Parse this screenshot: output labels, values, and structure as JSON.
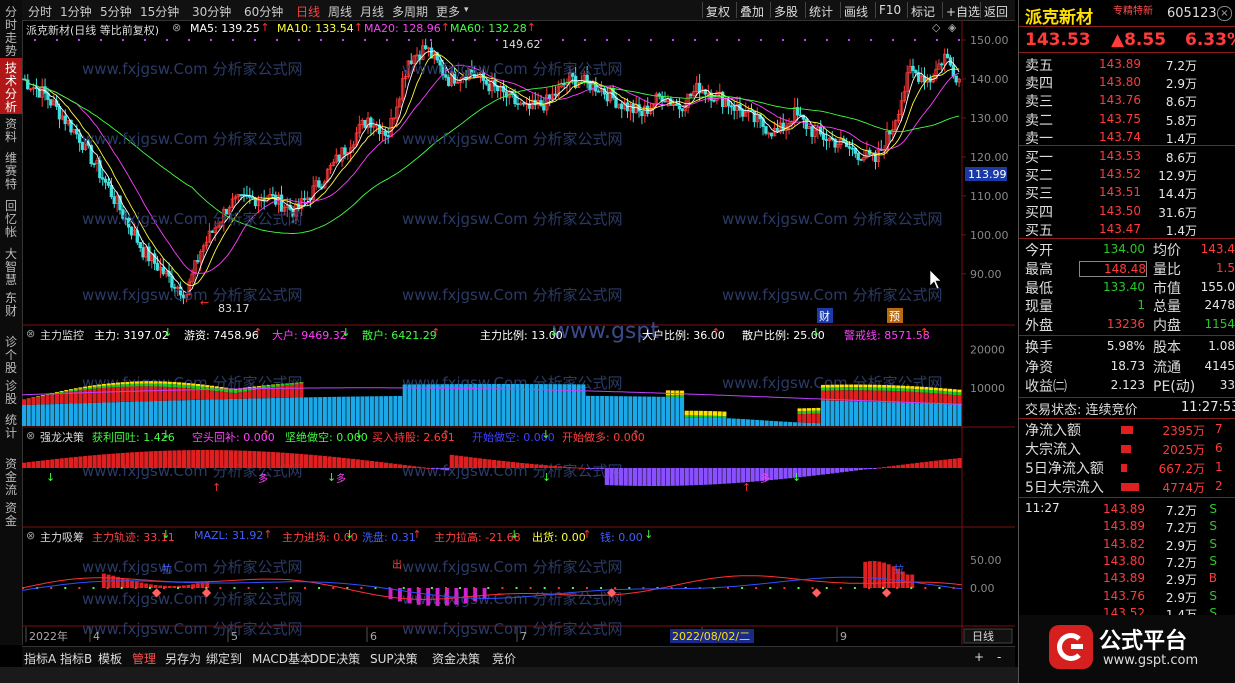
{
  "left_rail": [
    "分时走势",
    "技术分析",
    "资料",
    "维赛特",
    "回忆帐",
    "大智慧",
    "东财",
    "诊个股",
    "诊股",
    "统计",
    "资金流",
    "资金"
  ],
  "left_rail_active": 1,
  "toolbar": {
    "timeframes": [
      "分时",
      "1分钟",
      "5分钟",
      "15分钟",
      "30分钟",
      "60分钟",
      "日线",
      "周线",
      "月线",
      "多周期",
      "更多"
    ],
    "active_timeframe": "日线",
    "buttons": [
      "复权",
      "叠加",
      "多股",
      "统计",
      "画线",
      "F10",
      "标记",
      "+自选",
      "返回"
    ]
  },
  "main_chart": {
    "title": "派克新材(日线 等比前复权)",
    "ma": [
      {
        "label": "MA5: 139.25",
        "color": "#ffffff"
      },
      {
        "label": "MA10: 133.54",
        "color": "#ffff40"
      },
      {
        "label": "MA20: 128.96",
        "color": "#ff40ff"
      },
      {
        "label": "MA60: 132.28",
        "color": "#40ff40"
      }
    ],
    "high_label": "149.62",
    "low_label": "83.17",
    "current_price_box": "113.99",
    "price_axis": [
      "150.00",
      "140.00",
      "130.00",
      "120.00",
      "110.00",
      "100.00",
      "90.00"
    ],
    "markers": [
      "财",
      "预"
    ],
    "watermarks": [
      "www.fxjgsw.Com",
      "分析家公式网",
      "www.gspt"
    ]
  },
  "panel_zhuli": {
    "title": "主力监控",
    "items": [
      {
        "text": "主力: 3197.02",
        "color": "#ffffff"
      },
      {
        "text": "游资: 7458.96",
        "color": "#ffffff"
      },
      {
        "text": "大户: 9469.32",
        "color": "#ff40ff"
      },
      {
        "text": "散户: 6421.29",
        "color": "#40ff40"
      },
      {
        "text": "主力比例: 13.00",
        "color": "#ffffff"
      },
      {
        "text": "大户比例: 36.00",
        "color": "#ffffff"
      },
      {
        "text": "散户比例: 25.00",
        "color": "#ffffff"
      },
      {
        "text": "警戒线: 8571.58",
        "color": "#ff40ff"
      }
    ],
    "axis": [
      "20000",
      "10000"
    ]
  },
  "panel_qianglong": {
    "title": "强龙决策",
    "items": [
      {
        "text": "获利回吐: 1.426",
        "color": "#40ff40"
      },
      {
        "text": "空头回补: 0.000",
        "color": "#ff40ff"
      },
      {
        "text": "坚绝做空: 0.000",
        "color": "#40ff40"
      },
      {
        "text": "买入持股: 2.691",
        "color": "#ff4040"
      },
      {
        "text": "开始做空: 0.000",
        "color": "#4040ff"
      },
      {
        "text": "开始做多: 0.000",
        "color": "#ff4040"
      }
    ],
    "tags": [
      "多",
      "多",
      "多"
    ]
  },
  "panel_xichou": {
    "title": "主力吸筹",
    "items": [
      {
        "text": "主力轨迹: 33.11",
        "color": "#ff4040"
      },
      {
        "text": "MAZL: 31.92",
        "color": "#4060ff"
      },
      {
        "text": "主力进场: 0.00",
        "color": "#ff4040"
      },
      {
        "text": "洗盘: 0.31",
        "color": "#4060ff"
      },
      {
        "text": "主力拉高: -21.68",
        "color": "#ff4040"
      },
      {
        "text": "出货: 0.00",
        "color": "#ffff40"
      },
      {
        "text": "钱: 0.00",
        "color": "#4060ff"
      }
    ],
    "axis": [
      "50.00",
      "0.00"
    ],
    "tags": [
      "拉",
      "出",
      "拉"
    ]
  },
  "date_axis": {
    "labels": [
      "2022年",
      "4",
      "5",
      "6",
      "7",
      "8",
      "9"
    ],
    "cursor_date": "2022/08/02/二",
    "period": "日线"
  },
  "bottom_tabs": [
    "指标A",
    "指标B",
    "模板",
    "管理",
    "另存为",
    "绑定到",
    "MACD基本",
    "DDE决策",
    "SUP决策",
    "资金决策",
    "竞价"
  ],
  "bottom_active": "管理",
  "right_panel": {
    "name": "派克新材",
    "tag": "专精特新",
    "code": "605123",
    "price": "143.53",
    "change": "▲8.55",
    "pct": "6.33%",
    "asks": [
      {
        "label": "卖五",
        "price": "143.89",
        "vol": "7.2万"
      },
      {
        "label": "卖四",
        "price": "143.80",
        "vol": "2.9万"
      },
      {
        "label": "卖三",
        "price": "143.76",
        "vol": "8.6万"
      },
      {
        "label": "卖二",
        "price": "143.75",
        "vol": "5.8万"
      },
      {
        "label": "卖一",
        "price": "143.74",
        "vol": "1.4万"
      }
    ],
    "bids": [
      {
        "label": "买一",
        "price": "143.53",
        "vol": "8.6万"
      },
      {
        "label": "买二",
        "price": "143.52",
        "vol": "12.9万"
      },
      {
        "label": "买三",
        "price": "143.51",
        "vol": "14.4万"
      },
      {
        "label": "买四",
        "price": "143.50",
        "vol": "31.6万"
      },
      {
        "label": "买五",
        "price": "143.47",
        "vol": "1.4万"
      }
    ],
    "stats": [
      {
        "l1": "今开",
        "v1": "134.00",
        "c1": "green",
        "l2": "均价",
        "v2": "143.4",
        "c2": "red"
      },
      {
        "l1": "最高",
        "v1": "148.48",
        "c1": "red",
        "l2": "量比",
        "v2": "1.5",
        "c2": "red"
      },
      {
        "l1": "最低",
        "v1": "133.40",
        "c1": "green",
        "l2": "市值",
        "v2": "155.0",
        "c2": "white"
      },
      {
        "l1": "现量",
        "v1": "1",
        "c1": "green",
        "l2": "总量",
        "v2": "2478",
        "c2": "white"
      },
      {
        "l1": "外盘",
        "v1": "13236",
        "c1": "red",
        "l2": "内盘",
        "v2": "1154",
        "c2": "green"
      }
    ],
    "stats2": [
      {
        "l1": "换手",
        "v1": "5.98%",
        "l2": "股本",
        "v2": "1.08"
      },
      {
        "l1": "净资",
        "v1": "18.73",
        "l2": "流通",
        "v2": "4145"
      },
      {
        "l1": "收益㈡",
        "v1": "2.123",
        "l2": "PE(动)",
        "v2": "33"
      }
    ],
    "trade_status_label": "交易状态: 连续竞价",
    "trade_time": "11:27:53",
    "flows": [
      {
        "label": "净流入额",
        "value": "2395万",
        "extra": "7"
      },
      {
        "label": "大宗流入",
        "value": "2025万",
        "extra": "6"
      },
      {
        "label": "5日净流入额",
        "value": "667.2万",
        "extra": "1"
      },
      {
        "label": "5日大宗流入",
        "value": "4774万",
        "extra": "2"
      }
    ],
    "ticks": [
      {
        "time": "11:27",
        "price": "143.89",
        "vol": "7.2万",
        "bs": "S"
      },
      {
        "time": "",
        "price": "143.89",
        "vol": "7.2万",
        "bs": "S"
      },
      {
        "time": "",
        "price": "143.82",
        "vol": "2.9万",
        "bs": "S"
      },
      {
        "time": "",
        "price": "143.80",
        "vol": "7.2万",
        "bs": "S"
      },
      {
        "time": "",
        "price": "143.89",
        "vol": "2.9万",
        "bs": "B"
      },
      {
        "time": "",
        "price": "143.76",
        "vol": "2.9万",
        "bs": "S"
      },
      {
        "time": "",
        "price": "143.52",
        "vol": "1.4万",
        "bs": "S"
      }
    ]
  },
  "brand": {
    "name": "公式平台",
    "url": "www.gspt.com"
  },
  "colors": {
    "up": "#ff3b3b",
    "down": "#40e0e0",
    "bg": "#000000"
  }
}
